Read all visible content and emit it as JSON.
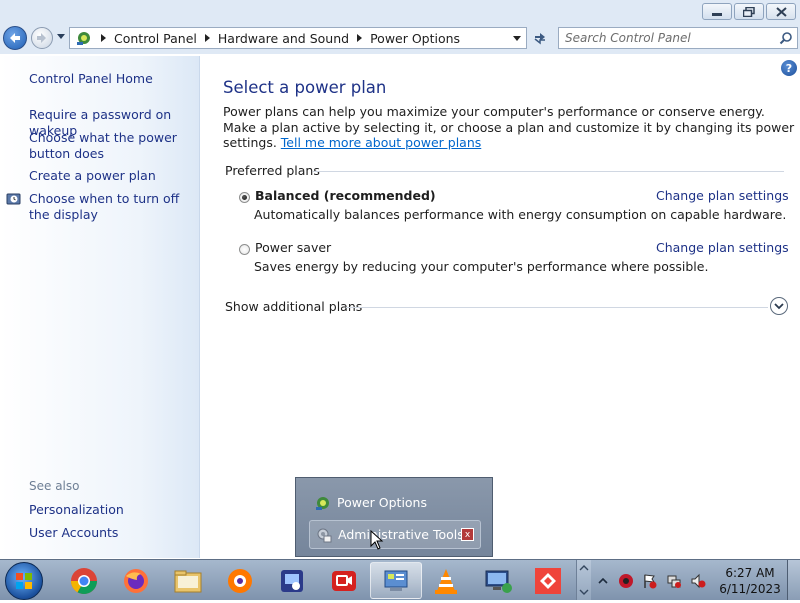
{
  "window": {
    "breadcrumb": [
      "Control Panel",
      "Hardware and Sound",
      "Power Options"
    ],
    "search_placeholder": "Search Control Panel"
  },
  "sidebar": {
    "home": "Control Panel Home",
    "links": [
      "Require a password on wakeup",
      "Choose what the power button does",
      "Create a power plan",
      "Choose when to turn off the display"
    ],
    "see_also_label": "See also",
    "see_also": [
      "Personalization",
      "User Accounts"
    ]
  },
  "main": {
    "title": "Select a power plan",
    "intro_text": "Power plans can help you maximize your computer's performance or conserve energy. Make a plan active by selecting it, or choose a plan and customize it by changing its power settings. ",
    "intro_link": "Tell me more about power plans",
    "preferred_label": "Preferred plans",
    "plans": [
      {
        "name": "Balanced (recommended)",
        "description": "Automatically balances performance with energy consumption on capable hardware.",
        "link": "Change plan settings",
        "selected": true
      },
      {
        "name": "Power saver",
        "description": "Saves energy by reducing your computer's performance where possible.",
        "link": "Change plan settings",
        "selected": false
      }
    ],
    "show_additional": "Show additional plans",
    "help": "?"
  },
  "popup": {
    "items": [
      "Power Options",
      "Administrative Tools"
    ],
    "close_glyph": "x"
  },
  "taskbar": {
    "apps": [
      "chrome-icon",
      "firefox-icon",
      "explorer-icon",
      "avast-icon",
      "remote-app-icon",
      "recorder-icon",
      "control-panel-icon",
      "vlc-icon",
      "remote-desktop-icon",
      "anydesk-icon"
    ],
    "time": "6:27 AM",
    "date": "6/11/2023"
  },
  "colors": {
    "link": "#1e3287",
    "hyperlink": "#0066cc",
    "chrome": "#dfe9f5"
  }
}
